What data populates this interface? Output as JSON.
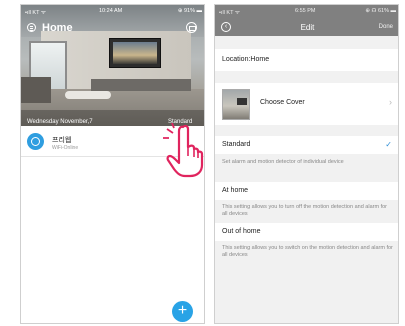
{
  "left_screen": {
    "status_bar": {
      "carrier": "•ıll KT ᯤ",
      "time": "10:24 AM",
      "battery": "⊕ 91% ▬"
    },
    "header": {
      "title": "Home"
    },
    "hero": {
      "date": "Wednesday November,7",
      "mode": "Standard"
    },
    "device": {
      "name": "프리웹",
      "status": "WiFi-Online"
    },
    "fab_label": "+"
  },
  "right_screen": {
    "status_bar": {
      "carrier": "•ıll KT ᯤ",
      "time": "6:55 PM",
      "battery": "⊕ ☊ 61% ▬"
    },
    "header": {
      "back": "‹",
      "title": "Edit",
      "done": "Done"
    },
    "location": "Location:Home",
    "cover": {
      "label": "Choose Cover",
      "chevron": "›"
    },
    "options": [
      {
        "label": "Standard",
        "checked": true,
        "check": "✓",
        "description": "Set alarm and motion detector of individual device"
      },
      {
        "label": "At home",
        "checked": false,
        "description": "This setting allows you to turn off the motion detection and alarm for all devices"
      },
      {
        "label": "Out of home",
        "checked": false,
        "description": "This setting allows you to switch on the motion detection and alarm for all devices"
      }
    ]
  },
  "colors": {
    "accent": "#29a3e6",
    "header_gray": "#808080",
    "check_blue": "#2f8fd6"
  },
  "icons": [
    "menu-icon",
    "camera-icon",
    "device-icon",
    "add-icon",
    "pointing-hand-icon",
    "back-icon",
    "check-icon",
    "chevron-right-icon"
  ]
}
